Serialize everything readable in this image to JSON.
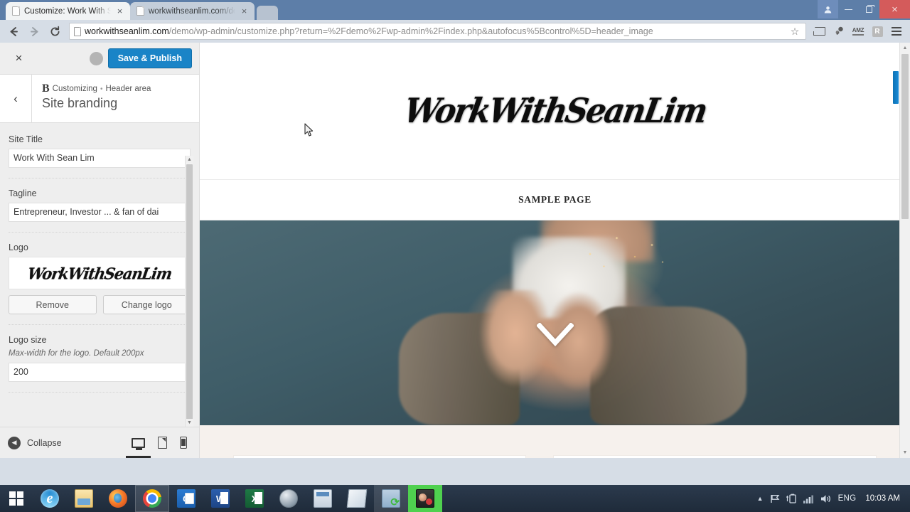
{
  "browser": {
    "tabs": [
      {
        "title": "Customize: Work With Se",
        "active": true,
        "favicon": "page-icon",
        "close": "×"
      },
      {
        "title": "workwithseanlim.com/de",
        "active": false,
        "favicon": "page-icon",
        "close": "×"
      }
    ],
    "window_controls": {
      "profile": "👤",
      "minimize": "–",
      "maximize": "❐",
      "close": "×"
    },
    "toolbar": {
      "back": "←",
      "forward": "→",
      "reload": "⟳",
      "bookmark_star": "☆",
      "url_host": "workwithseanlim.com",
      "url_path": "/demo/wp-admin/customize.php?return=%2Fdemo%2Fwp-admin%2Findex.php&autofocus%5Bcontrol%5D=header_image",
      "extensions": [
        {
          "name": "cast-icon",
          "label": ""
        },
        {
          "name": "extension-icon",
          "label": ""
        },
        {
          "name": "amz-extension-icon",
          "label": "AMZ"
        },
        {
          "name": "r-extension-icon",
          "label": "R"
        }
      ],
      "menu": "☰"
    }
  },
  "customizer": {
    "close_label": "×",
    "save_label": "Save & Publish",
    "back_label": "‹",
    "breadcrumb": {
      "logo_letter": "B",
      "customizing": "Customizing",
      "separator": "•",
      "section": "Header area"
    },
    "panel_title": "Site branding",
    "controls": {
      "site_title": {
        "label": "Site Title",
        "value": "Work With Sean Lim"
      },
      "tagline": {
        "label": "Tagline",
        "value": "Entrepreneur, Investor ... & fan of dai"
      },
      "logo": {
        "label": "Logo",
        "image_text": "WorkWithSeanLim",
        "remove_label": "Remove",
        "change_label": "Change logo"
      },
      "logo_size": {
        "label": "Logo size",
        "description": "Max-width for the logo. Default 200px",
        "value": "200"
      }
    },
    "footer": {
      "collapse_label": "Collapse",
      "collapse_icon": "◀",
      "devices": [
        {
          "name": "desktop",
          "active": true
        },
        {
          "name": "tablet",
          "active": false
        },
        {
          "name": "mobile",
          "active": false
        }
      ]
    },
    "scroll_arrows": {
      "up": "▲",
      "down": "▼"
    }
  },
  "preview": {
    "site_logo": "WorkWithSeanLim",
    "nav": [
      {
        "label": "SAMPLE PAGE"
      }
    ],
    "hero": {
      "scroll_chevron": "chevron-down-icon"
    },
    "scroll_arrows": {
      "up": "▲",
      "down": "▼"
    }
  },
  "taskbar": {
    "start": "windows-logo",
    "items": [
      {
        "name": "internet-explorer",
        "icon": "ic-ie",
        "glyph": "e",
        "state": "idle"
      },
      {
        "name": "file-explorer",
        "icon": "ic-folder",
        "glyph": "",
        "state": "idle"
      },
      {
        "name": "firefox",
        "icon": "ic-ff",
        "glyph": "",
        "state": "idle"
      },
      {
        "name": "google-chrome",
        "icon": "ic-chrome",
        "glyph": "",
        "state": "running"
      },
      {
        "name": "outlook",
        "icon": "ic-outlook",
        "glyph": "O",
        "state": "idle"
      },
      {
        "name": "word",
        "icon": "ic-word",
        "glyph": "W",
        "state": "idle"
      },
      {
        "name": "excel",
        "icon": "ic-excel",
        "glyph": "X",
        "state": "idle"
      },
      {
        "name": "media-player",
        "icon": "ic-ball",
        "glyph": "",
        "state": "idle"
      },
      {
        "name": "calculator",
        "icon": "ic-calc",
        "glyph": "",
        "state": "idle"
      },
      {
        "name": "notepad",
        "icon": "ic-note",
        "glyph": "",
        "state": "idle"
      },
      {
        "name": "sync-tool",
        "icon": "ic-sync",
        "glyph": "",
        "state": "running"
      },
      {
        "name": "photo-app",
        "icon": "ic-photo",
        "glyph": "",
        "state": "green"
      }
    ],
    "tray": {
      "show_hidden": "▲",
      "icons": [
        "flag-icon",
        "battery-icon",
        "network-icon",
        "volume-icon"
      ],
      "language": "ENG",
      "clock": "10:03 AM"
    }
  }
}
